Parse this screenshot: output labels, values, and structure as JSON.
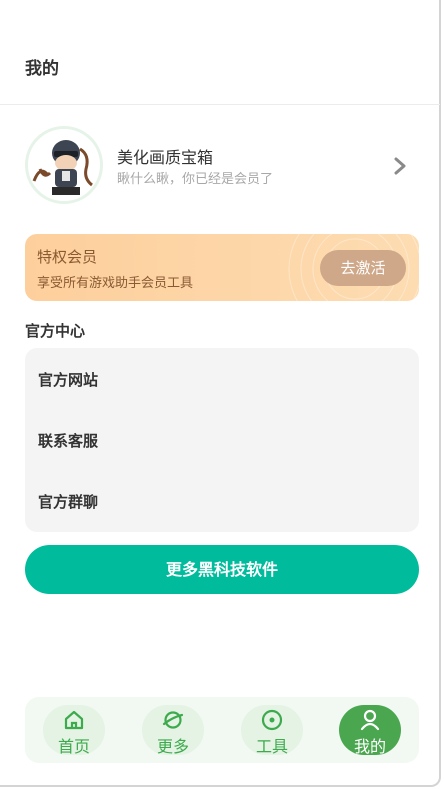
{
  "header": {
    "title": "我的"
  },
  "profile": {
    "name": "美化画质宝箱",
    "subtitle": "瞅什么瞅，你已经是会员了"
  },
  "vip": {
    "title": "特权会员",
    "desc": "享受所有游戏助手会员工具",
    "button": "去激活"
  },
  "official": {
    "title": "官方中心",
    "items": [
      {
        "label": "官方网站"
      },
      {
        "label": "联系客服"
      },
      {
        "label": "官方群聊"
      }
    ]
  },
  "more_button": "更多黑科技软件",
  "tabbar": {
    "tabs": [
      {
        "label": "首页",
        "icon": "home-icon"
      },
      {
        "label": "更多",
        "icon": "planet-icon"
      },
      {
        "label": "工具",
        "icon": "compass-icon"
      },
      {
        "label": "我的",
        "icon": "user-icon",
        "active": true
      }
    ]
  },
  "colors": {
    "accent": "#00bc9c",
    "tab_green": "#4aa750",
    "vip_bg": "#fdcf9c"
  }
}
